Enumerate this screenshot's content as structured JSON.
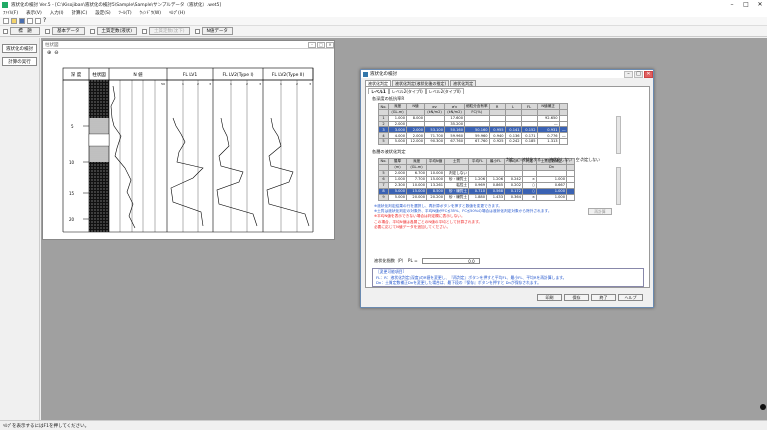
{
  "window_title": "液状化の検討 Ver.5 - [C:\\Kisojiban\\液状化の検討5\\Sample\\Sample\\サンプルデータ（液状化）.wet5]",
  "menu": [
    "ﾌｧｲﾙ(F)",
    "表示(V)",
    "入力(I)",
    "計算(C)",
    "設定(S)",
    "ﾂｰﾙ(T)",
    "ｳｨﾝﾄﾞｳ(W)",
    "ﾍﾙﾌﾟ(H)"
  ],
  "toolbar2": [
    {
      "label": "標　題",
      "enabled": true
    },
    {
      "label": "基本データ",
      "enabled": true
    },
    {
      "label": "土質定数(液状)",
      "enabled": true
    },
    {
      "label": "土質定数(沈下)",
      "enabled": false
    },
    {
      "label": "N値データ",
      "enabled": true
    }
  ],
  "left_buttons": [
    "液状化の検討",
    "計算の実行"
  ],
  "status": "ﾍﾙﾌﾟを表示するにはF1を押してください。",
  "log_window": {
    "title": "柱状図",
    "headers": [
      "深 度",
      "柱状図",
      "N 値",
      "FL LV1",
      "FL LV2(Type I)",
      "FL LV2(Type II)"
    ],
    "depth_ticks": [
      "5",
      "10",
      "15",
      "20"
    ],
    "n_ticks": [
      "10",
      "20",
      "30",
      "40",
      "50"
    ],
    "fl_ticks": [
      "1",
      "2",
      "3"
    ]
  },
  "dialog": {
    "title": "液状化の検討",
    "tabs": [
      "液状化判定",
      "液状化判定(液状化後の推定)",
      "液状化判定"
    ],
    "subtabs": [
      "レベル1",
      "レベル2(タイプI)",
      "レベル2(タイプII)"
    ],
    "section1": "各深度の抵抗率R",
    "table1": {
      "headers": [
        "No.",
        "深度",
        "N値",
        "σv",
        "σ'v",
        "細粒分含有率",
        "R",
        "L",
        "FL",
        "N値補正",
        ""
      ],
      "units": [
        "",
        "(GL-m)",
        "",
        "(kN/m2)",
        "(kN/m2)",
        "FC(%)",
        "",
        "",
        "",
        "",
        ""
      ],
      "rows": [
        [
          "1",
          "1.000",
          "8.000",
          "",
          "17.600",
          "",
          "",
          "",
          "",
          "92.650",
          ""
        ],
        [
          "2",
          "2.000",
          "",
          "",
          "35.200",
          "",
          "",
          "",
          "",
          "―",
          ""
        ],
        [
          "3",
          "3.000",
          "2.000",
          "53.100",
          "50.160",
          "50.160",
          "0.955",
          "0.141",
          "0.152",
          "0.931",
          "―"
        ],
        [
          "4",
          "4.000",
          "2.000",
          "71.700",
          "59.960",
          "59.960",
          "0.940",
          "0.136",
          "0.171",
          "0.776",
          "―"
        ],
        [
          "5",
          "5.000",
          "12.000",
          "90.300",
          "67.760",
          "67.760",
          "0.925",
          "0.242",
          "0.185",
          "1.313",
          ""
        ]
      ]
    },
    "section2": "各層の液状化判定",
    "legend": "判定　○:液状化する　×:液状化しない　空:判定しない",
    "table2": {
      "headers": [
        "No.",
        "層厚",
        "深度",
        "平均N値",
        "土質",
        "平均FL",
        "最小FL",
        "平均R",
        "判定",
        "土質定数補正",
        ""
      ],
      "units": [
        "",
        "(m)",
        "(GL-m)",
        "",
        "",
        "",
        "",
        "",
        "",
        "Dn",
        ""
      ],
      "rows": [
        [
          "5",
          "2.000",
          "6.700",
          "10.000",
          "判定しない",
          "",
          "",
          "",
          "",
          "",
          ""
        ],
        [
          "6",
          "1.000",
          "7.700",
          "15.000",
          "砂・礫質土",
          "1.206",
          "1.206",
          "0.242",
          "×",
          "1.000",
          ""
        ],
        [
          "7",
          "2.300",
          "10.000",
          "13.261",
          "粘性土",
          "0.969",
          "0.865",
          "0.202",
          "○",
          "0.667",
          ""
        ],
        [
          "8",
          "5.000",
          "15.000",
          "8.500",
          "砂・礫質土",
          "0.710",
          "0.568",
          "0.172",
          "○",
          "1.000",
          ""
        ],
        [
          "9",
          "5.000",
          "20.000",
          "20.200",
          "砂・礫質土",
          "1.880",
          "1.433",
          "0.364",
          "×",
          "1.000",
          ""
        ]
      ]
    },
    "recalc_label": "再計算",
    "notes": [
      {
        "text": "※液状化判定結果の行を選択し、再計算ボタンを押すと数値を変更できます。",
        "color": "blue"
      },
      {
        "text": "※土質は液状化判定の対象外、平均N値がFC≦35%、FC≦50%の場合は液状化判定対象から除外されます。",
        "color": "blue"
      },
      {
        "text": "※平均N値を表示できない場合は判定欄に表示しない。",
        "color": "red"
      },
      {
        "text": "この場合、平均N値は各層ごとのN値の平均として計算されます。",
        "color": "red"
      },
      {
        "text": "必要に応じてN値データを追加してください。",
        "color": "red"
      }
    ],
    "fl_label": "液状化指数（P）　PL =",
    "fl_value": "0.0",
    "info_title": "［変更可能項目］",
    "info_lines": [
      "FL：R：液状化判定(深度)のR値を変更し、『再判定』ボタンを押すと平均FL、最小FL、平均Rを再計算します。",
      "Dn：土質定数補正Dnを変更した場合は、最下段の『保存』ボタンを押すと Dnが保存されます。"
    ],
    "buttons": [
      "印刷",
      "保存",
      "終了",
      "ヘルプ"
    ]
  },
  "colors": {
    "selection": "#3a62b3",
    "mdi_bg": "#a0a0a0",
    "note_red": "#ee2222",
    "note_blue": "#2255cc"
  }
}
